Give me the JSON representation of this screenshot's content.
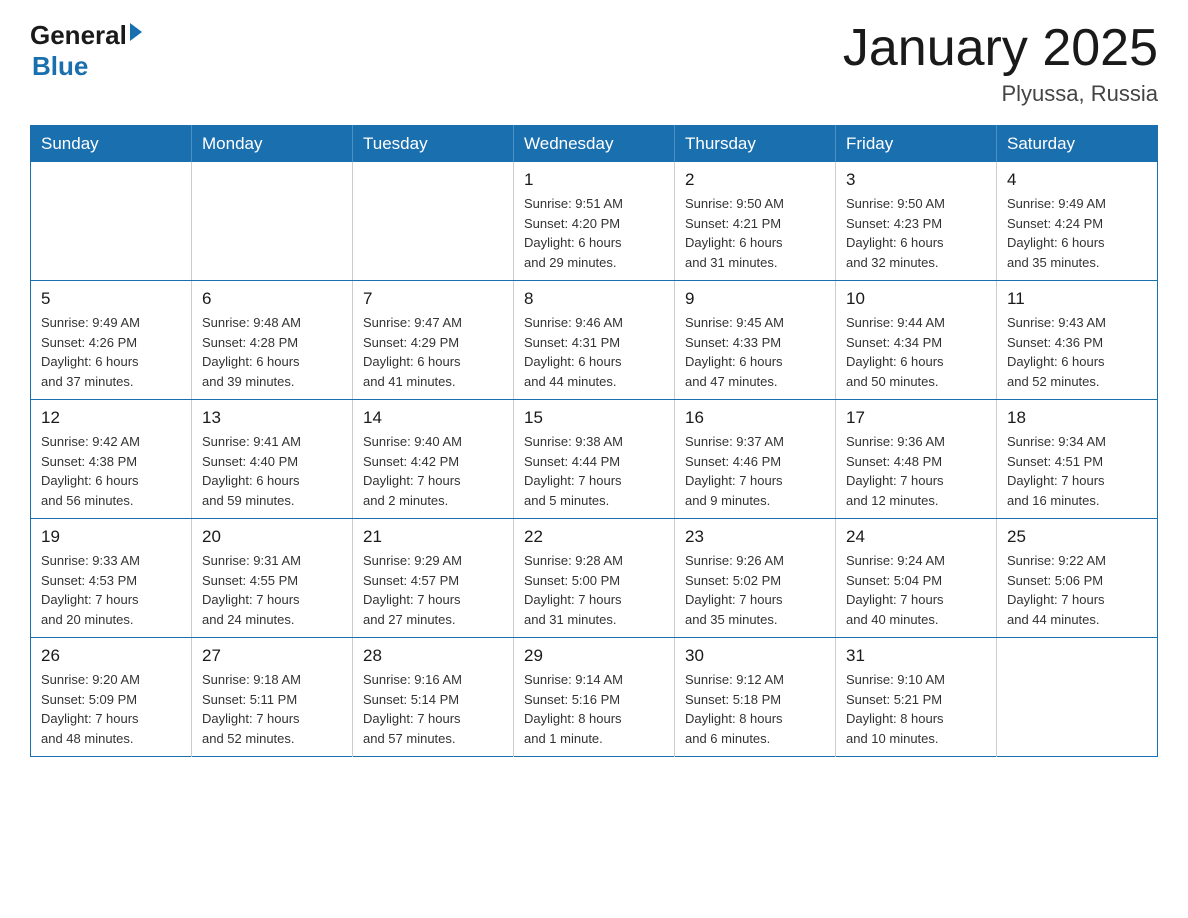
{
  "logo": {
    "text_general": "General",
    "text_blue": "Blue",
    "arrow": "▶"
  },
  "title": "January 2025",
  "subtitle": "Plyussa, Russia",
  "days_of_week": [
    "Sunday",
    "Monday",
    "Tuesday",
    "Wednesday",
    "Thursday",
    "Friday",
    "Saturday"
  ],
  "weeks": [
    [
      {
        "day": "",
        "info": ""
      },
      {
        "day": "",
        "info": ""
      },
      {
        "day": "",
        "info": ""
      },
      {
        "day": "1",
        "info": "Sunrise: 9:51 AM\nSunset: 4:20 PM\nDaylight: 6 hours\nand 29 minutes."
      },
      {
        "day": "2",
        "info": "Sunrise: 9:50 AM\nSunset: 4:21 PM\nDaylight: 6 hours\nand 31 minutes."
      },
      {
        "day": "3",
        "info": "Sunrise: 9:50 AM\nSunset: 4:23 PM\nDaylight: 6 hours\nand 32 minutes."
      },
      {
        "day": "4",
        "info": "Sunrise: 9:49 AM\nSunset: 4:24 PM\nDaylight: 6 hours\nand 35 minutes."
      }
    ],
    [
      {
        "day": "5",
        "info": "Sunrise: 9:49 AM\nSunset: 4:26 PM\nDaylight: 6 hours\nand 37 minutes."
      },
      {
        "day": "6",
        "info": "Sunrise: 9:48 AM\nSunset: 4:28 PM\nDaylight: 6 hours\nand 39 minutes."
      },
      {
        "day": "7",
        "info": "Sunrise: 9:47 AM\nSunset: 4:29 PM\nDaylight: 6 hours\nand 41 minutes."
      },
      {
        "day": "8",
        "info": "Sunrise: 9:46 AM\nSunset: 4:31 PM\nDaylight: 6 hours\nand 44 minutes."
      },
      {
        "day": "9",
        "info": "Sunrise: 9:45 AM\nSunset: 4:33 PM\nDaylight: 6 hours\nand 47 minutes."
      },
      {
        "day": "10",
        "info": "Sunrise: 9:44 AM\nSunset: 4:34 PM\nDaylight: 6 hours\nand 50 minutes."
      },
      {
        "day": "11",
        "info": "Sunrise: 9:43 AM\nSunset: 4:36 PM\nDaylight: 6 hours\nand 52 minutes."
      }
    ],
    [
      {
        "day": "12",
        "info": "Sunrise: 9:42 AM\nSunset: 4:38 PM\nDaylight: 6 hours\nand 56 minutes."
      },
      {
        "day": "13",
        "info": "Sunrise: 9:41 AM\nSunset: 4:40 PM\nDaylight: 6 hours\nand 59 minutes."
      },
      {
        "day": "14",
        "info": "Sunrise: 9:40 AM\nSunset: 4:42 PM\nDaylight: 7 hours\nand 2 minutes."
      },
      {
        "day": "15",
        "info": "Sunrise: 9:38 AM\nSunset: 4:44 PM\nDaylight: 7 hours\nand 5 minutes."
      },
      {
        "day": "16",
        "info": "Sunrise: 9:37 AM\nSunset: 4:46 PM\nDaylight: 7 hours\nand 9 minutes."
      },
      {
        "day": "17",
        "info": "Sunrise: 9:36 AM\nSunset: 4:48 PM\nDaylight: 7 hours\nand 12 minutes."
      },
      {
        "day": "18",
        "info": "Sunrise: 9:34 AM\nSunset: 4:51 PM\nDaylight: 7 hours\nand 16 minutes."
      }
    ],
    [
      {
        "day": "19",
        "info": "Sunrise: 9:33 AM\nSunset: 4:53 PM\nDaylight: 7 hours\nand 20 minutes."
      },
      {
        "day": "20",
        "info": "Sunrise: 9:31 AM\nSunset: 4:55 PM\nDaylight: 7 hours\nand 24 minutes."
      },
      {
        "day": "21",
        "info": "Sunrise: 9:29 AM\nSunset: 4:57 PM\nDaylight: 7 hours\nand 27 minutes."
      },
      {
        "day": "22",
        "info": "Sunrise: 9:28 AM\nSunset: 5:00 PM\nDaylight: 7 hours\nand 31 minutes."
      },
      {
        "day": "23",
        "info": "Sunrise: 9:26 AM\nSunset: 5:02 PM\nDaylight: 7 hours\nand 35 minutes."
      },
      {
        "day": "24",
        "info": "Sunrise: 9:24 AM\nSunset: 5:04 PM\nDaylight: 7 hours\nand 40 minutes."
      },
      {
        "day": "25",
        "info": "Sunrise: 9:22 AM\nSunset: 5:06 PM\nDaylight: 7 hours\nand 44 minutes."
      }
    ],
    [
      {
        "day": "26",
        "info": "Sunrise: 9:20 AM\nSunset: 5:09 PM\nDaylight: 7 hours\nand 48 minutes."
      },
      {
        "day": "27",
        "info": "Sunrise: 9:18 AM\nSunset: 5:11 PM\nDaylight: 7 hours\nand 52 minutes."
      },
      {
        "day": "28",
        "info": "Sunrise: 9:16 AM\nSunset: 5:14 PM\nDaylight: 7 hours\nand 57 minutes."
      },
      {
        "day": "29",
        "info": "Sunrise: 9:14 AM\nSunset: 5:16 PM\nDaylight: 8 hours\nand 1 minute."
      },
      {
        "day": "30",
        "info": "Sunrise: 9:12 AM\nSunset: 5:18 PM\nDaylight: 8 hours\nand 6 minutes."
      },
      {
        "day": "31",
        "info": "Sunrise: 9:10 AM\nSunset: 5:21 PM\nDaylight: 8 hours\nand 10 minutes."
      },
      {
        "day": "",
        "info": ""
      }
    ]
  ]
}
